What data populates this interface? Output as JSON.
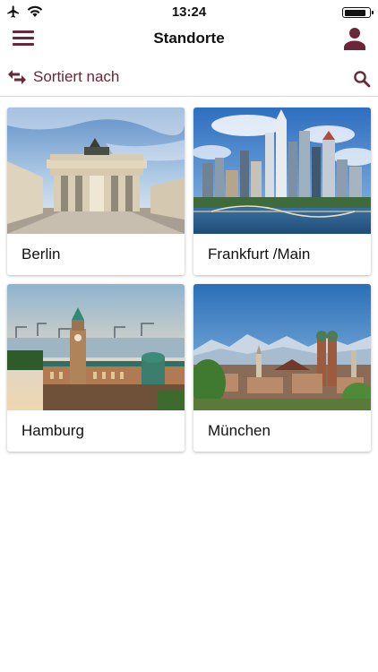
{
  "status_bar": {
    "time": "13:24",
    "icons": [
      "airplane-icon",
      "wifi-icon",
      "battery-icon"
    ],
    "battery_level": 0.9
  },
  "nav": {
    "title": "Standorte",
    "left_icon": "menu-icon",
    "right_icon": "user-icon"
  },
  "sort": {
    "label": "Sortiert nach",
    "icon": "swap-arrows-icon",
    "search_icon": "search-icon"
  },
  "colors": {
    "accent": "#6b2637",
    "divider": "#d8d8d8",
    "background": "#ffffff"
  },
  "locations": [
    {
      "name": "Berlin",
      "image": "brandenburg-gate-photo"
    },
    {
      "name": "Frankfurt /Main",
      "image": "frankfurt-skyline-photo"
    },
    {
      "name": "Hamburg",
      "image": "hamburg-harbour-photo"
    },
    {
      "name": "München",
      "image": "munich-skyline-photo"
    }
  ]
}
